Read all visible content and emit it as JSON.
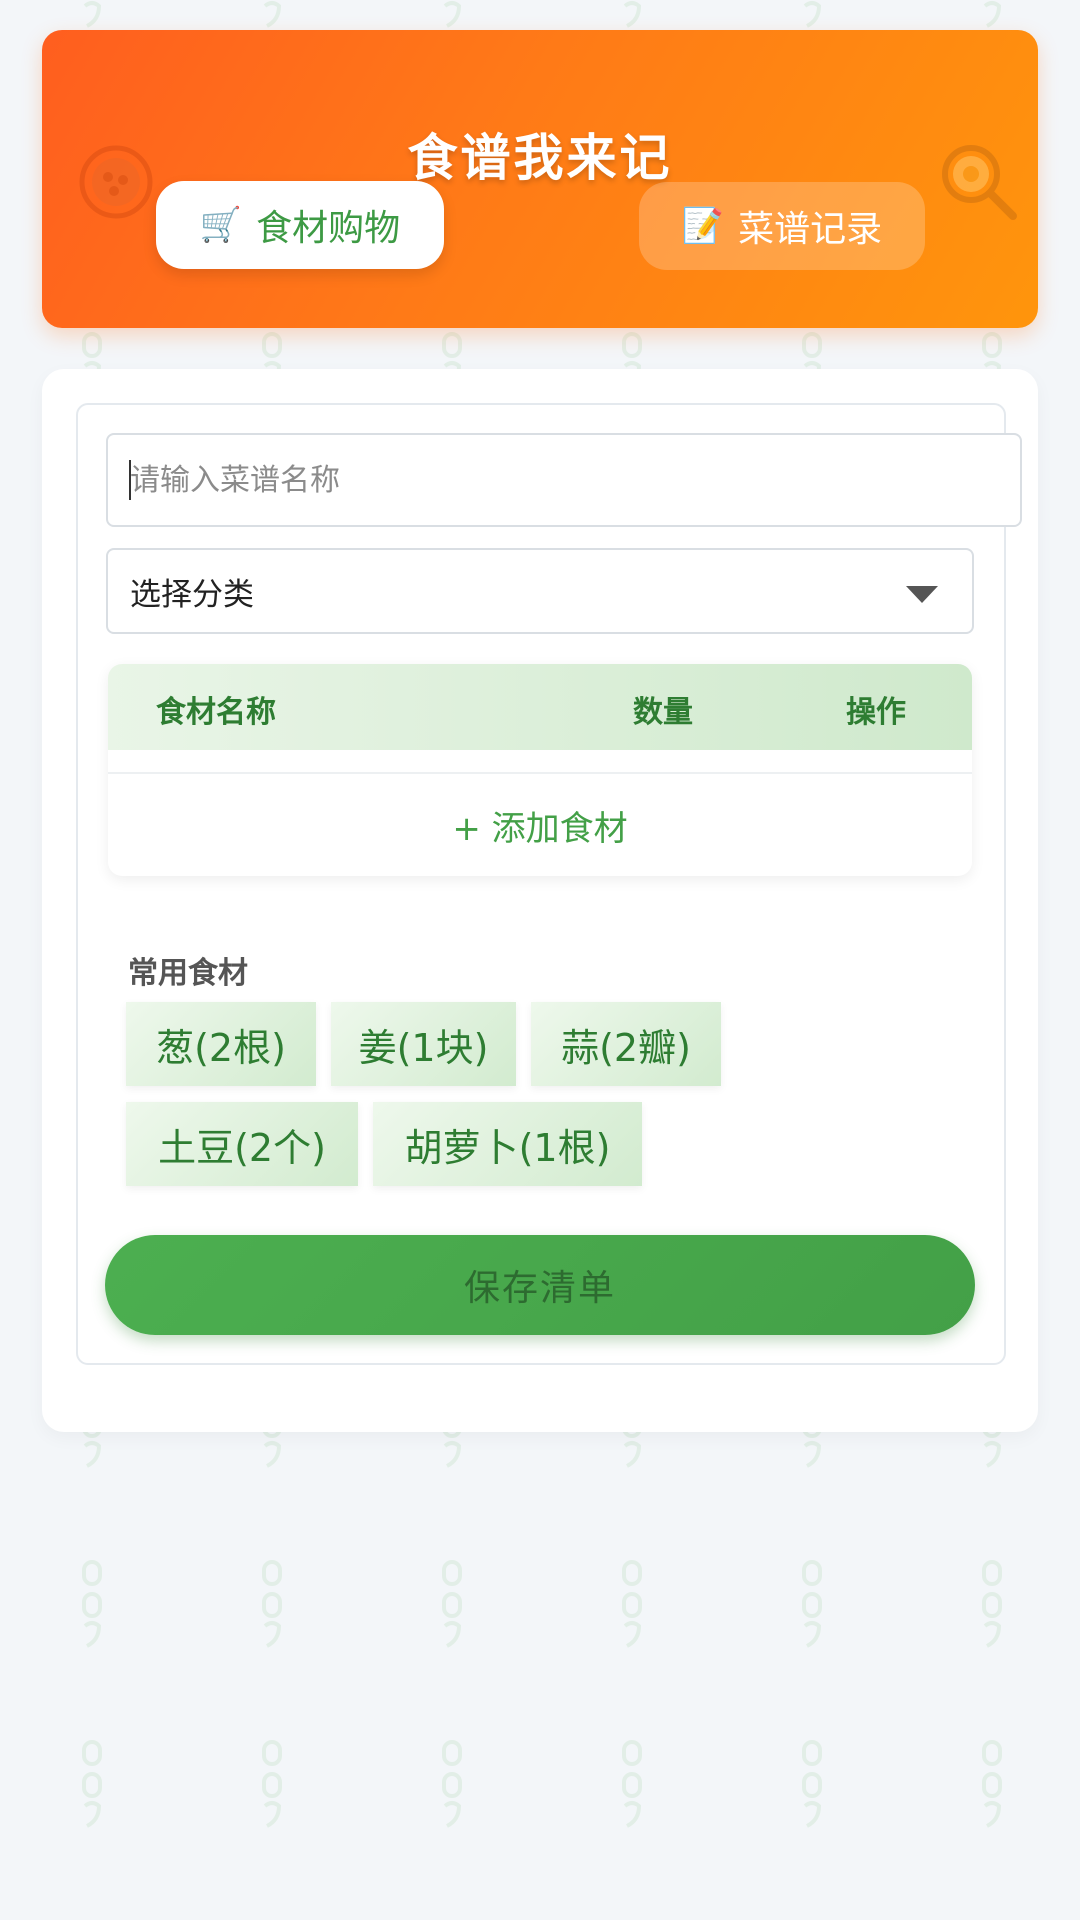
{
  "header": {
    "title": "食谱我来记",
    "tabs": [
      {
        "emoji": "🛒",
        "label": "食材购物"
      },
      {
        "emoji": "📝",
        "label": "菜谱记录"
      }
    ]
  },
  "form": {
    "recipe_name_placeholder": "请输入菜谱名称",
    "recipe_name_value": "",
    "category_selected": "选择分类"
  },
  "ingredient_table": {
    "columns": [
      "食材名称",
      "数量",
      "操作"
    ],
    "rows": [],
    "add_label": "+ 添加食材"
  },
  "common_ingredients": {
    "label": "常用食材",
    "items": [
      "葱(2根)",
      "姜(1块)",
      "蒜(2瓣)",
      "土豆(2个)",
      "胡萝卜(1根)"
    ]
  },
  "save_button_label": "保存清单",
  "colors": {
    "header_start": "#ff5e1f",
    "header_end": "#ff950c",
    "accent_green": "#43a047",
    "text_green": "#2e7d32"
  }
}
